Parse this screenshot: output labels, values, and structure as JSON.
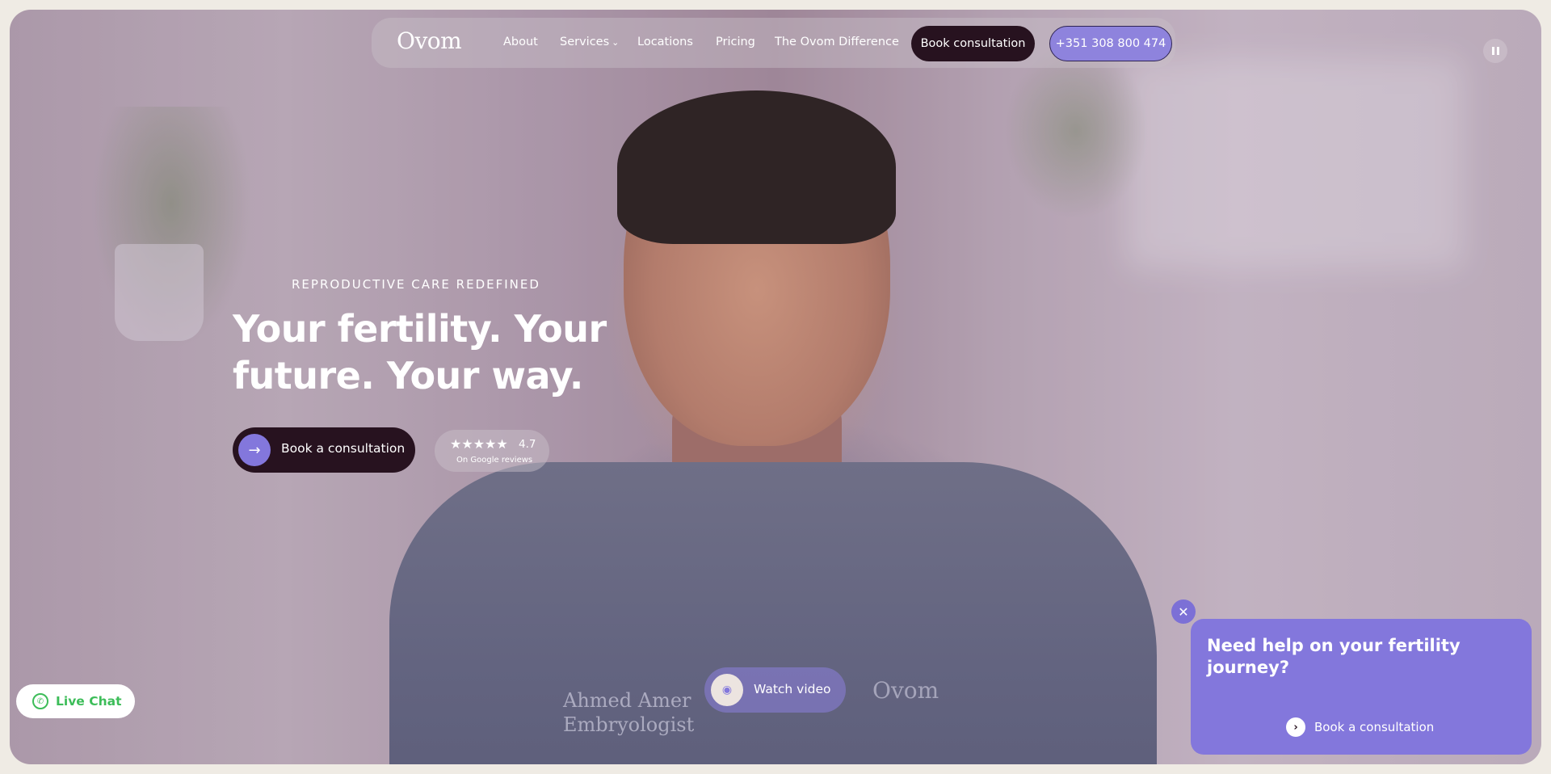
{
  "nav": {
    "logo": "Ovom",
    "links": [
      "About",
      "Services",
      "Locations",
      "Pricing",
      "The Ovom Difference"
    ],
    "book_label": "Book consultation",
    "phone_label": "+351 308 800 474"
  },
  "hero": {
    "eyebrow": "REPRODUCTIVE CARE REDEFINED",
    "headline": "Your fertility. Your future. Your way.",
    "cta_label": "Book a consultation",
    "rating": {
      "stars": "★★★★★",
      "value": "4.7",
      "caption": "On Google reviews"
    },
    "watch_label": "Watch video",
    "scrubs_name": "Ahmed Amer",
    "scrubs_role": "Embryologist",
    "scrubs_logo": "Ovom"
  },
  "live_chat": {
    "label": "Live Chat"
  },
  "help_card": {
    "title": "Need help on your fertility journey?",
    "cta_label": "Book a consultation"
  },
  "colors": {
    "accent": "#8377dc",
    "dark": "#27121f",
    "whatsapp": "#3dbd59"
  }
}
